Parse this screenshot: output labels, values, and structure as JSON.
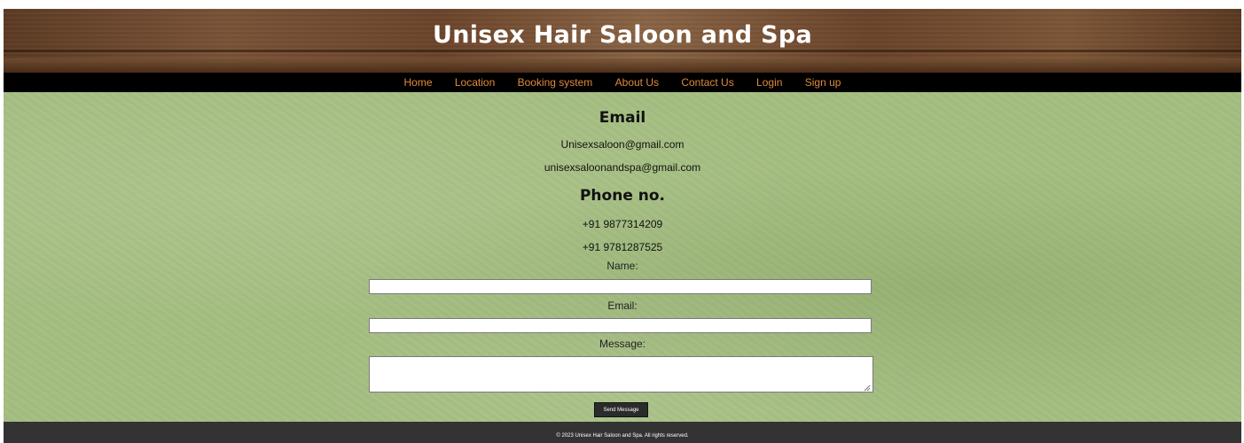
{
  "header": {
    "title": "Unisex Hair Saloon and Spa"
  },
  "nav": {
    "items": [
      {
        "label": "Home"
      },
      {
        "label": "Location"
      },
      {
        "label": "Booking system"
      },
      {
        "label": "About Us"
      },
      {
        "label": "Contact Us"
      },
      {
        "label": "Login"
      },
      {
        "label": "Sign up"
      }
    ]
  },
  "contact": {
    "email_heading": "Email",
    "emails": [
      "Unisexsaloon@gmail.com",
      "unisexsaloonandspa@gmail.com"
    ],
    "phone_heading": "Phone no.",
    "phones": [
      "+91 9877314209",
      "+91 9781287525"
    ]
  },
  "form": {
    "name_label": "Name:",
    "name_value": "",
    "email_label": "Email:",
    "email_value": "",
    "message_label": "Message:",
    "message_value": "",
    "submit_label": "Send Message"
  },
  "footer": {
    "text": "© 2023 Unisex Hair Saloon and Spa. All rights reserved."
  },
  "colors": {
    "nav_link": "#e08a3c",
    "nav_background": "#000000",
    "content_background": "#a4bd80",
    "footer_background": "#333333"
  }
}
